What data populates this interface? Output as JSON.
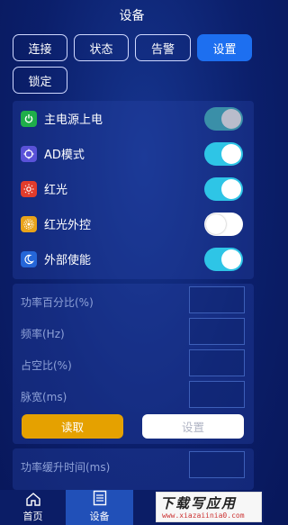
{
  "title": "设备",
  "tabs": [
    {
      "label": "连接",
      "active": false
    },
    {
      "label": "状态",
      "active": false
    },
    {
      "label": "告警",
      "active": false
    },
    {
      "label": "设置",
      "active": true
    },
    {
      "label": "锁定",
      "active": false
    }
  ],
  "toggles": [
    {
      "label": "主电源上电",
      "icon": "power-icon",
      "icon_color": "#1fae4a",
      "on": true,
      "disabled_look": true
    },
    {
      "label": "AD模式",
      "icon": "crosshair-icon",
      "icon_color": "#5a52d8",
      "on": true
    },
    {
      "label": "红光",
      "icon": "sun-icon",
      "icon_color": "#e13c2c",
      "on": true
    },
    {
      "label": "红光外控",
      "icon": "radiate-icon",
      "icon_color": "#e9a31a",
      "on": false
    },
    {
      "label": "外部使能",
      "icon": "moon-icon",
      "icon_color": "#2566d8",
      "on": true
    }
  ],
  "fields": [
    {
      "label": "功率百分比(%)",
      "value": ""
    },
    {
      "label": "频率(Hz)",
      "value": ""
    },
    {
      "label": "占空比(%)",
      "value": ""
    },
    {
      "label": "脉宽(ms)",
      "value": ""
    }
  ],
  "buttons": {
    "read": "读取",
    "set": "设置"
  },
  "field_extra": {
    "label": "功率缓升时间(ms)",
    "value": ""
  },
  "nav": [
    {
      "label": "首页",
      "icon": "home-icon",
      "active": false
    },
    {
      "label": "设备",
      "icon": "device-list-icon",
      "active": true
    }
  ],
  "watermark": {
    "line1": "下载写应用",
    "line2": "www.xiazaiinia0.com"
  },
  "colors": {
    "accent": "#1d6ff0",
    "toggle_on": "#2ec5e6",
    "read_btn": "#e5a100"
  }
}
